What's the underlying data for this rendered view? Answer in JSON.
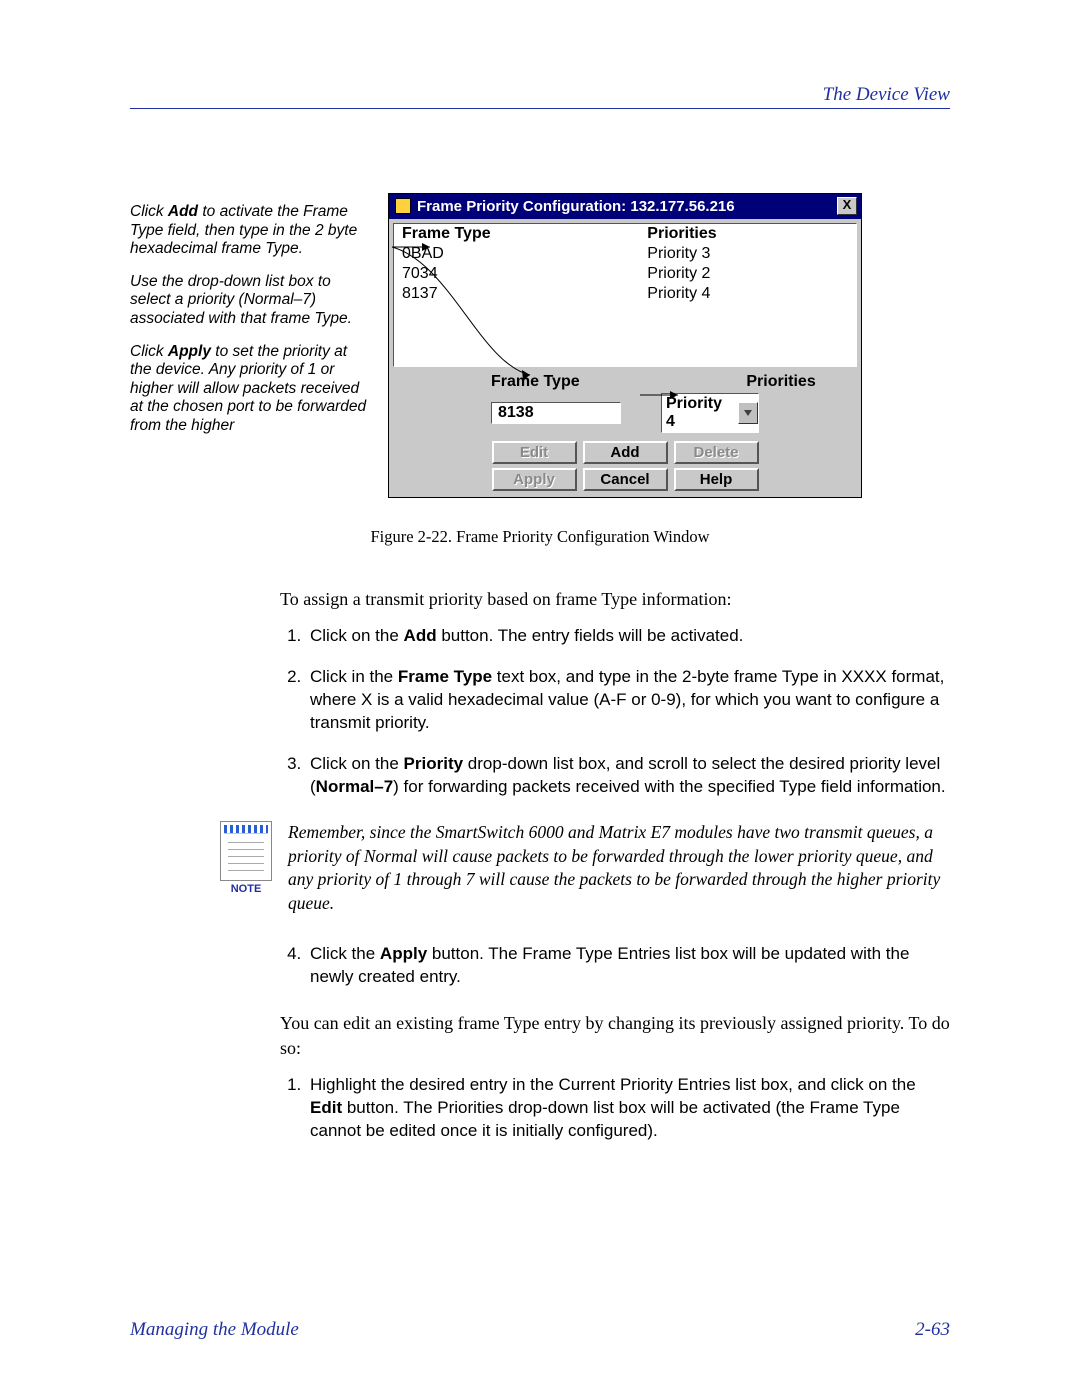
{
  "header": {
    "section": "The Device View"
  },
  "sideNotes": {
    "p1a": "Click ",
    "p1b": "Add",
    "p1c": " to activate the Frame Type field, then type in the 2 byte hexadecimal frame Type.",
    "p2": "Use the drop-down list box to select a priority (Normal–7) associated with that frame Type.",
    "p3a": "Click ",
    "p3b": "Apply",
    "p3c": " to set the priority at the device. Any priority of 1 or higher will allow packets received at the chosen port to be forwarded from the higher"
  },
  "window": {
    "title": "Frame Priority Configuration: 132.177.56.216",
    "headers": {
      "col1": "Frame Type",
      "col2": "Priorities"
    },
    "rows": [
      {
        "type": "0BAD",
        "prio": "Priority 3"
      },
      {
        "type": "7034",
        "prio": "Priority 2"
      },
      {
        "type": "8137",
        "prio": "Priority 4"
      }
    ],
    "inputLabels": {
      "type": "Frame Type",
      "prio": "Priorities"
    },
    "inputValue": "8138",
    "comboValue": "Priority 4",
    "buttons": {
      "edit": "Edit",
      "add": "Add",
      "delete": "Delete",
      "apply": "Apply",
      "cancel": "Cancel",
      "help": "Help"
    },
    "close": "X"
  },
  "caption": "Figure 2-22. Frame Priority Configuration Window",
  "body": {
    "intro": "To assign a transmit priority based on frame Type information:",
    "step1a": "Click on the ",
    "step1b": "Add",
    "step1c": " button. The entry fields will be activated.",
    "step2a": "Click in the ",
    "step2b": "Frame Type",
    "step2c": " text box, and type in the 2-byte frame Type in XXXX format, where X is a valid hexadecimal value (A-F or 0-9), for which you want to configure a transmit priority.",
    "step3a": "Click on the ",
    "step3b": "Priority",
    "step3c": " drop-down list box, and scroll to select the desired priority level (",
    "step3d": "Normal–7",
    "step3e": ") for forwarding packets received with the specified Type field information.",
    "note": "Remember, since the SmartSwitch 6000 and Matrix E7 modules have two transmit queues, a priority of Normal will cause packets to be forwarded through the lower priority queue, and any priority of 1 through 7 will cause the packets to be forwarded through the higher priority queue.",
    "noteLabel": "NOTE",
    "step4a": "Click the ",
    "step4b": "Apply",
    "step4c": " button. The Frame Type Entries list box will be updated with the newly created entry.",
    "editIntro": "You can edit an existing frame Type entry by changing its previously assigned priority. To do so:",
    "edit1a": "Highlight the desired entry in the Current Priority Entries list box, and click on the ",
    "edit1b": "Edit",
    "edit1c": " button. The Priorities drop-down list box will be activated (the Frame Type cannot be edited once it is initially configured)."
  },
  "footer": {
    "left": "Managing the Module",
    "right": "2-63"
  }
}
